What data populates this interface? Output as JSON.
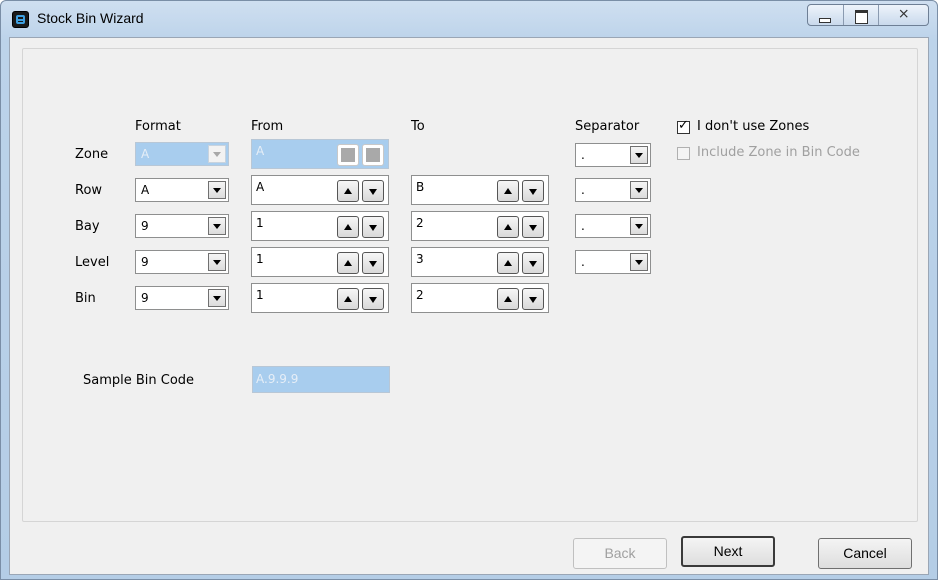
{
  "window": {
    "title": "Stock Bin Wizard",
    "close_glyph": "⨯"
  },
  "headers": {
    "format": "Format",
    "from": "From",
    "to": "To",
    "separator": "Separator"
  },
  "rows": [
    {
      "label": "Zone",
      "format": "A",
      "from": "A",
      "to": "",
      "separator": "."
    },
    {
      "label": "Row",
      "format": "A",
      "from": "A",
      "to": "B",
      "separator": "."
    },
    {
      "label": "Bay",
      "format": "9",
      "from": "1",
      "to": "2",
      "separator": "."
    },
    {
      "label": "Level",
      "format": "9",
      "from": "1",
      "to": "3",
      "separator": "."
    },
    {
      "label": "Bin",
      "format": "9",
      "from": "1",
      "to": "2",
      "separator": ""
    }
  ],
  "options": {
    "no_zones": {
      "label": "I don't use Zones",
      "checked": true
    },
    "include_zone": {
      "label": "Include Zone in Bin Code",
      "checked": false
    }
  },
  "sample": {
    "label": "Sample Bin Code",
    "value": "A.9.9.9"
  },
  "buttons": {
    "back": "Back",
    "next": "Next",
    "cancel": "Cancel"
  }
}
